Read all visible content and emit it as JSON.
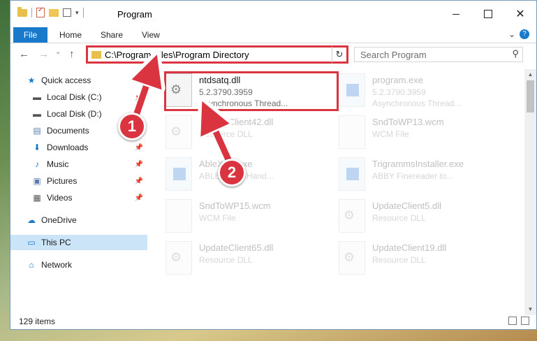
{
  "window": {
    "title": "Program"
  },
  "ribbon": {
    "tabs": [
      "File",
      "Home",
      "Share",
      "View"
    ],
    "help": "?"
  },
  "nav": {
    "back": "←",
    "forward": "→",
    "up": "↑"
  },
  "address": {
    "path": "C:\\Program Files\\Program Directory",
    "refresh": "↻",
    "dropdown": "⌄"
  },
  "search": {
    "placeholder": "Search Program",
    "icon": "⚲"
  },
  "sidebar": {
    "items": [
      {
        "label": "Quick access"
      },
      {
        "label": "Local Disk (C:)"
      },
      {
        "label": "Local Disk (D:)"
      },
      {
        "label": "Documents"
      },
      {
        "label": "Downloads"
      },
      {
        "label": "Music"
      },
      {
        "label": "Pictures"
      },
      {
        "label": "Videos"
      },
      {
        "label": "OneDrive"
      },
      {
        "label": "This PC"
      },
      {
        "label": "Network"
      }
    ]
  },
  "files": [
    {
      "name": "ntdsatq.dll",
      "line1": "5.2.3790.3959",
      "line2": "Asynchronous Thread..."
    },
    {
      "name": "program.exe",
      "line1": "5.2.3790.3959",
      "line2": "Asynchronous Thread..."
    },
    {
      "name": "UpdateClient42.dll",
      "line1": "Resource DLL",
      "line2": ""
    },
    {
      "name": "SndToWP13.wcm",
      "line1": "WCM File",
      "line2": ""
    },
    {
      "name": "AbleXXX.exe",
      "line1": "ABLE Event Hand...",
      "line2": ""
    },
    {
      "name": "TrigrammsInstaller.exe",
      "line1": "ABBY Finereader to...",
      "line2": ""
    },
    {
      "name": "SndToWP15.wcm",
      "line1": "WCM File",
      "line2": ""
    },
    {
      "name": "UpdateClient5.dll",
      "line1": "Resource DLL",
      "line2": ""
    },
    {
      "name": "UpdateClient65.dll",
      "line1": "Resource DLL",
      "line2": ""
    },
    {
      "name": "UpdateClient19.dll",
      "line1": "Resource DLL",
      "line2": ""
    }
  ],
  "status": {
    "count": "129 items"
  },
  "annotations": {
    "step1": "1",
    "step2": "2"
  },
  "colors": {
    "accent": "#1979ca",
    "highlight": "#d9343f",
    "selected": "#cce4f7"
  }
}
